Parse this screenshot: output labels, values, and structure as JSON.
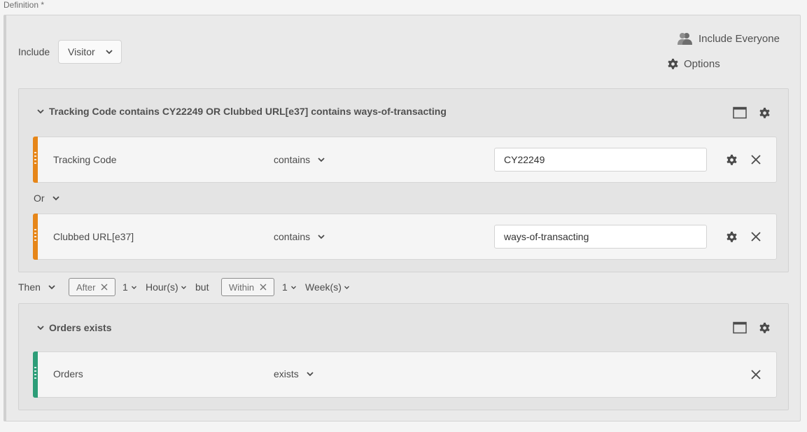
{
  "definition": {
    "label": "Definition *"
  },
  "include": {
    "label": "Include",
    "selected": "Visitor"
  },
  "actions": {
    "include_everyone": "Include Everyone",
    "options": "Options"
  },
  "container1": {
    "title": "Tracking Code contains CY22249 OR Clubbed URL[e37] contains ways-of-transacting",
    "rules": [
      {
        "dimension": "Tracking Code",
        "operator": "contains",
        "value": "CY22249",
        "color": "#e68619"
      },
      {
        "dimension": "Clubbed URL[e37]",
        "operator": "contains",
        "value": "ways-of-transacting",
        "color": "#e68619"
      }
    ],
    "logic": "Or"
  },
  "sequence": {
    "then": "Then",
    "after_chip": "After",
    "after_count": "1",
    "after_unit": "Hour(s)",
    "but": "but",
    "within_chip": "Within",
    "within_count": "1",
    "within_unit": "Week(s)"
  },
  "container2": {
    "title": "Orders exists",
    "rules": [
      {
        "dimension": "Orders",
        "operator": "exists",
        "color": "#2d9d78"
      }
    ]
  }
}
